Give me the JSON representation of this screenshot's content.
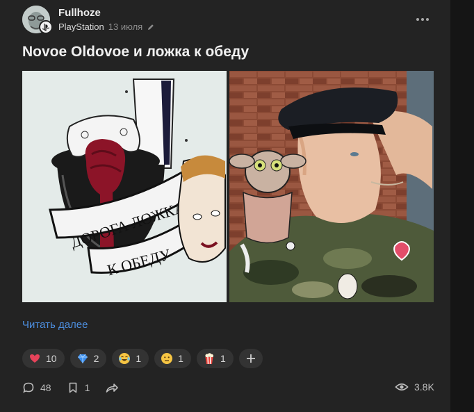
{
  "post": {
    "author": "Fullhoze",
    "community": "PlayStation",
    "date": "13 июля",
    "title": "Novoe Oldovoe и ложка к обеду",
    "read_more": "Читать далее",
    "left_image_text": {
      "line1": "ДОРОГА ЛОЖКА",
      "line2": "К ОБЕДУ"
    }
  },
  "reactions": [
    {
      "icon": "heart-icon",
      "count": "10"
    },
    {
      "icon": "diamond-icon",
      "count": "2"
    },
    {
      "icon": "laughing-face-icon",
      "count": "1"
    },
    {
      "icon": "neutral-face-icon",
      "count": "1"
    },
    {
      "icon": "popcorn-icon",
      "count": "1"
    }
  ],
  "footer": {
    "comments": "48",
    "bookmarks": "1",
    "views": "3.8K"
  },
  "colors": {
    "accent_link": "#4d8fe0",
    "card_bg": "#232323",
    "pill_bg": "#333333"
  }
}
